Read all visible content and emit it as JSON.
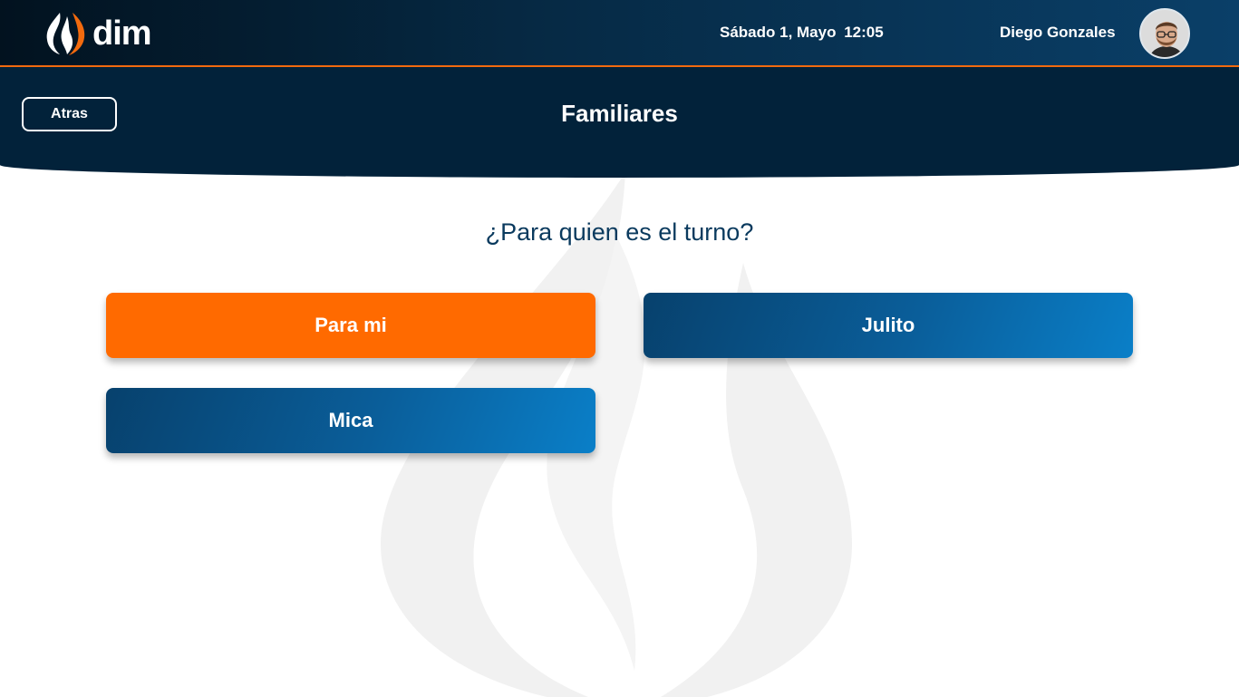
{
  "topbar": {
    "logo_text": "dim",
    "date": "Sábado 1, Mayo",
    "time": "12:05",
    "user_name": "Diego Gonzales"
  },
  "header": {
    "back_label": "Atras",
    "title": "Familiares"
  },
  "main": {
    "question": "¿Para quien es el turno?",
    "options": [
      {
        "label": "Para mi",
        "style": "orange"
      },
      {
        "label": "Julito",
        "style": "blue"
      },
      {
        "label": "Mica",
        "style": "blue"
      }
    ]
  },
  "colors": {
    "accent": "#ff6a00",
    "navy": "#02223a",
    "blue": "#0a5e9a"
  }
}
